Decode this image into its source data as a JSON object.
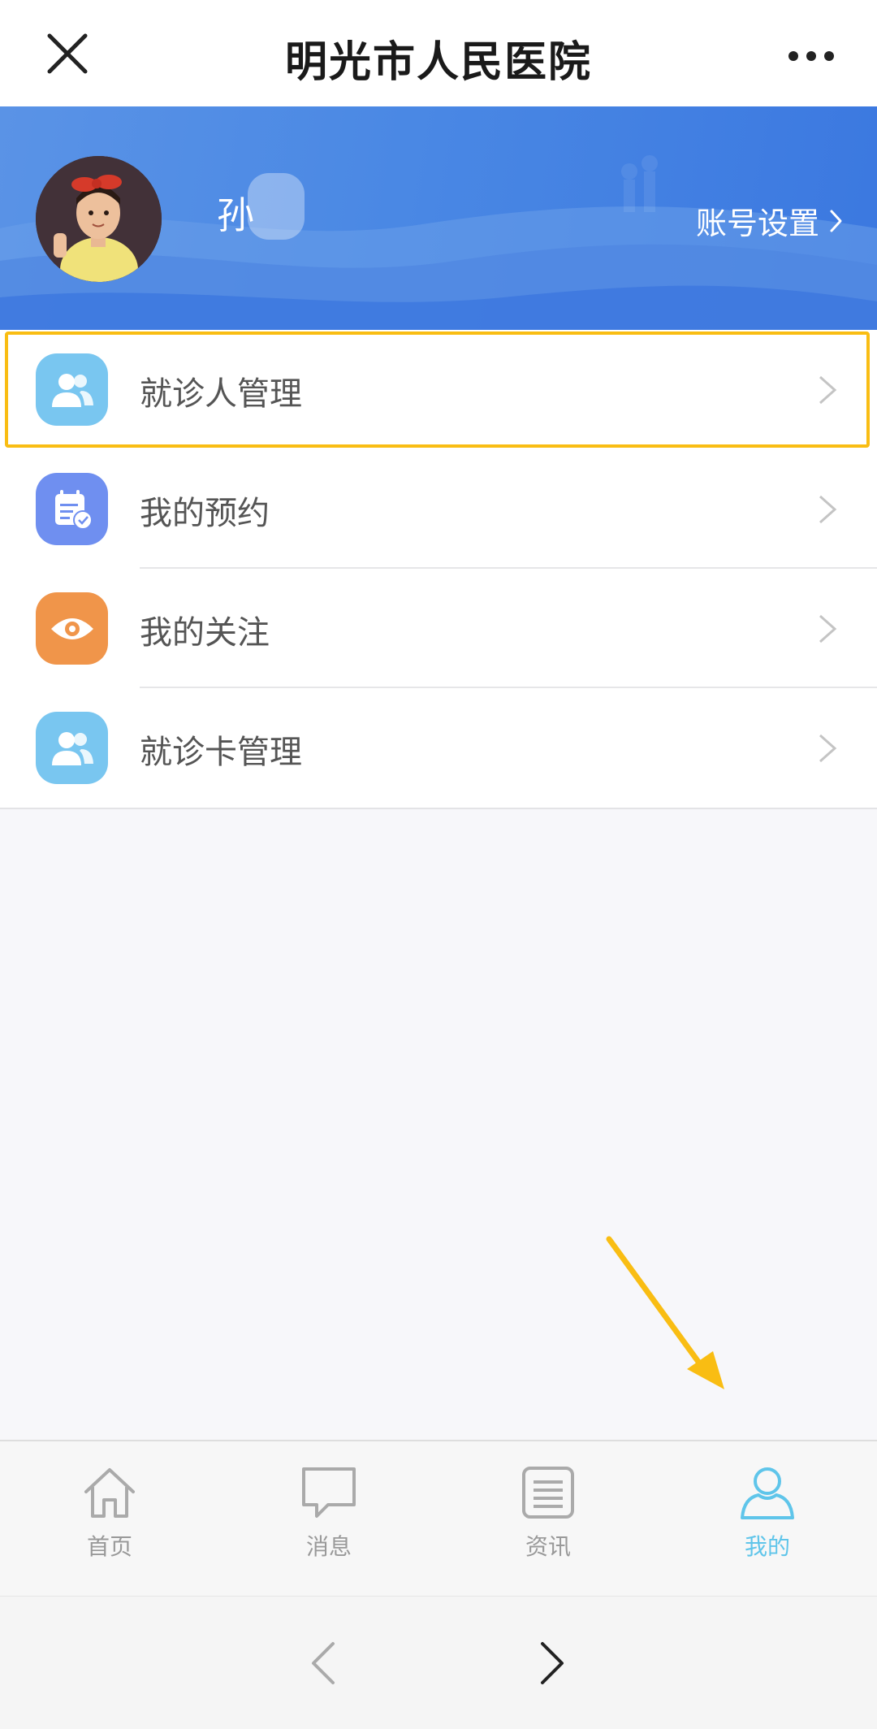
{
  "titlebar": {
    "title": "明光市人民医院",
    "close_icon": "close-icon",
    "more_icon": "more-icon"
  },
  "profile": {
    "username": "孙",
    "account_settings": "账号设置",
    "banner_color": "#4a88e4"
  },
  "menu": {
    "items": [
      {
        "label": "就诊人管理",
        "icon": "patients-icon",
        "color": "#79c6f0"
      },
      {
        "label": "我的预约",
        "icon": "appointment-icon",
        "color": "#6f8ff0"
      },
      {
        "label": "我的关注",
        "icon": "eye-icon",
        "color": "#f0954a"
      },
      {
        "label": "就诊卡管理",
        "icon": "card-users-icon",
        "color": "#79c6f0"
      }
    ],
    "highlight_color": "#f9bd13"
  },
  "tabbar": {
    "tabs": [
      {
        "label": "首页",
        "icon": "home-icon"
      },
      {
        "label": "消息",
        "icon": "message-icon"
      },
      {
        "label": "资讯",
        "icon": "news-icon"
      },
      {
        "label": "我的",
        "icon": "user-icon",
        "active": true
      }
    ],
    "active_color": "#5fc5ea",
    "inactive_color": "#999999"
  },
  "navbar": {
    "back_icon": "back-arrow-icon",
    "forward_icon": "forward-arrow-icon"
  }
}
